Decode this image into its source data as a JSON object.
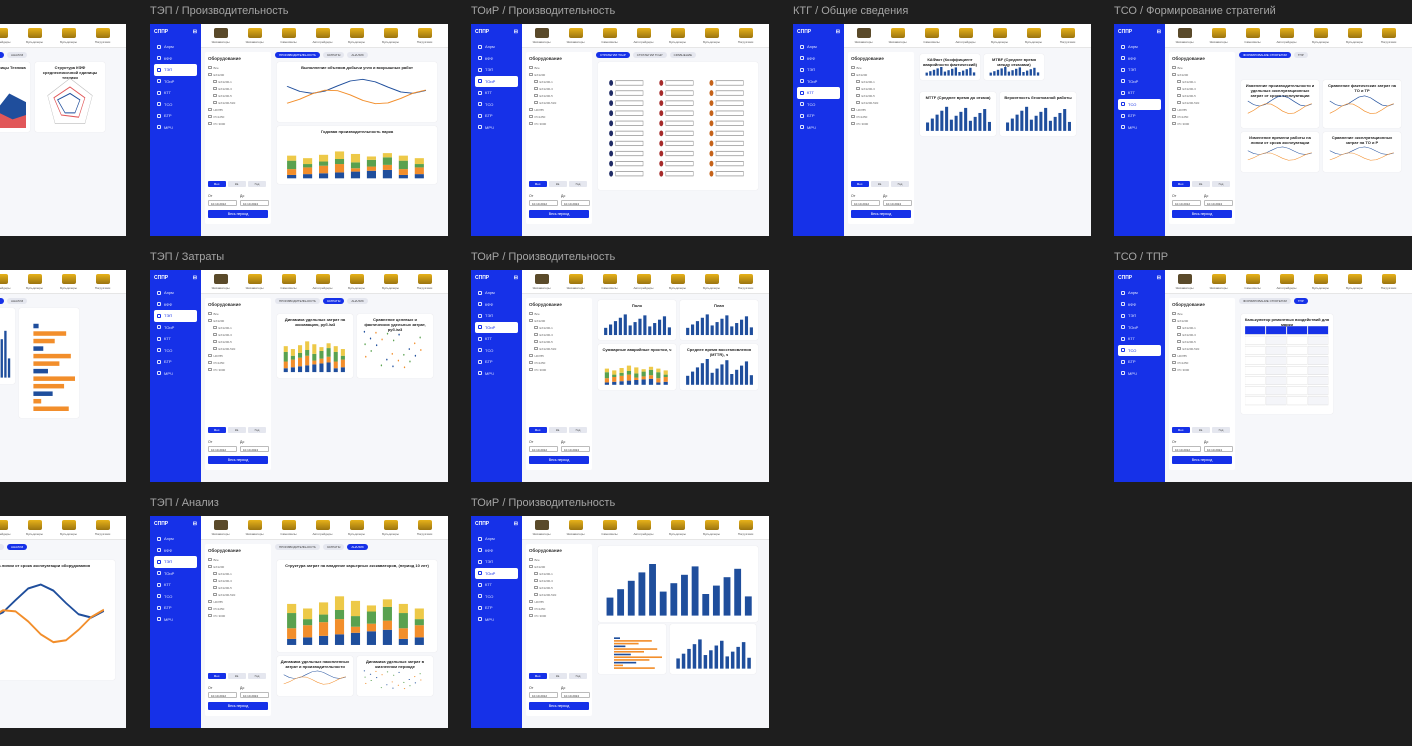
{
  "app": {
    "brand": "СППР"
  },
  "colors": {
    "sidebar": "#1631e8",
    "board_bg": "#ffffff",
    "canvas_bg": "#1e1e1e"
  },
  "sidebar_nav": [
    "Аэрм",
    "КФФ",
    "ТЭП",
    "ТОиР",
    "КТГ",
    "ТСО",
    "БТР",
    "МРЧ"
  ],
  "equipment": [
    "Экскаваторы",
    "Экскаваторы",
    "Самосвалы",
    "Автогрейдеры",
    "Бульдозеры",
    "Бульдозеры",
    "Погрузчики"
  ],
  "filters": {
    "title": "Оборудование",
    "items": [
      "Все",
      "EX1200",
      "EX1200-1",
      "EX1200-3",
      "EX1200-5",
      "EX1200-5КК",
      "HD785",
      "PC1250",
      "PC 3000"
    ],
    "periods": [
      "Мес.",
      "Кв.",
      "Год"
    ],
    "from_label": "От",
    "to_label": "До",
    "from_value": "10.10.2012",
    "to_value": "10.10.2024",
    "button": "Весь период"
  },
  "frames": [
    {
      "id": "f1",
      "title": "",
      "active_nav": 2,
      "tabs": [
        "",
        "ДЕТАЛЬНАЯ СТРУКТУРА КФФ",
        "АНАЛИЗ"
      ],
      "active_tab": 1,
      "cards": [
        {
          "title": "Структура КФФ единицы Техника",
          "chart": "area"
        },
        {
          "title": "Структура КФФ среднесписочной единицы техники",
          "chart": "radar"
        }
      ]
    },
    {
      "id": "f2",
      "title": "ТЭП / Производительность",
      "active_nav": 2,
      "tabs": [
        "ПРОИЗВОДИТЕЛЬНОСТЬ",
        "ЗАТРАТЫ",
        "АНАЛИЗ"
      ],
      "active_tab": 0,
      "cards": [
        {
          "title": "Выполнение объемов добычи угля и вскрышных работ",
          "chart": "line"
        },
        {
          "title": "Годовая производительность парка",
          "chart": "stack"
        }
      ]
    },
    {
      "id": "f3",
      "title": "ТОиР / Производительность",
      "active_nav": 3,
      "tabs": [
        "СТРАТЕГИИ ТОиР",
        "СТРАТЕГИИ ТОиР",
        "СРАВНЕНИЕ"
      ],
      "active_tab": 0,
      "cards": [
        {
          "title": "",
          "chart": "timeline"
        }
      ]
    },
    {
      "id": "f4",
      "title": "КТГ / Общие сведения",
      "active_nav": 4,
      "tabs": [],
      "active_tab": -1,
      "cards": [
        {
          "title": "КАФакт (Коэффициент аварийности фактический)",
          "chart": "bars"
        },
        {
          "title": "MTBF (Среднее время между отказами)",
          "chart": "bars"
        },
        {
          "title": "MTTF (Среднее время до отказа)",
          "chart": "bars"
        },
        {
          "title": "Вероятность безотказной работы",
          "chart": "bars"
        }
      ]
    },
    {
      "id": "f5",
      "title": "ТСО / Формирование стратегий",
      "active_nav": 5,
      "tabs": [
        "ФОРМИРОВАНИЕ СТРАТЕГИИ",
        "ТПР"
      ],
      "active_tab": 0,
      "cards": [
        {
          "title": "Изменение производительности и удельных эксплуатационных затрат от срока эксплуатации",
          "chart": "line"
        },
        {
          "title": "Сравнение фактических затрат на ТО и ТР",
          "chart": "line"
        },
        {
          "title": "Изменение времени работы на линии от срока эксплуатации",
          "chart": "line"
        },
        {
          "title": "Сравнение эксплуатационных затрат на ТО и Р",
          "chart": "line"
        }
      ]
    },
    {
      "id": "f6",
      "title": "",
      "active_nav": 2,
      "tabs": [
        "ДЕТАЛЬНАЯ СТРУКТУРА КФФ",
        "АНАЛИЗ"
      ],
      "active_tab": 0,
      "cards": [
        {
          "title": "",
          "chart": "bars"
        },
        {
          "title": "",
          "chart": "hbars"
        }
      ]
    },
    {
      "id": "f7",
      "title": "ТЭП / Затраты",
      "active_nav": 2,
      "tabs": [
        "ПРОИЗВОДИТЕЛЬНОСТЬ",
        "ЗАТРАТЫ",
        "АНАЛИЗ"
      ],
      "active_tab": 1,
      "cards": [
        {
          "title": "Динамика удельных затрат на экскавацию, руб./м3",
          "chart": "stack"
        },
        {
          "title": "Сравнение целевых и фактических удельных затрат, руб./м3",
          "chart": "scatter"
        }
      ]
    },
    {
      "id": "f8",
      "title": "ТОиР / Производительность",
      "active_nav": 3,
      "tabs": [],
      "active_tab": -1,
      "cards": [
        {
          "title": "Поло",
          "chart": "bars"
        },
        {
          "title": "План",
          "chart": "bars"
        },
        {
          "title": "Суммарные аварийные простои, ч",
          "chart": "stack"
        },
        {
          "title": "Среднее время восстановления (MTTR), ч",
          "chart": "bars"
        }
      ]
    },
    {
      "id": "f9",
      "title": "ТСО / ТПР",
      "active_nav": 5,
      "tabs": [
        "ФОРМИРОВАНИЕ СТРАТЕГИИ",
        "ТПР"
      ],
      "active_tab": 1,
      "cards": [
        {
          "title": "Калькулятор ремонтных воздействий для марки",
          "chart": "table"
        }
      ]
    },
    {
      "id": "f10",
      "title": "",
      "active_nav": 2,
      "tabs": [
        "ДЕТАЛЬНАЯ СТРУКТУРА КФФ",
        "АНАЛИЗ"
      ],
      "active_tab": 1,
      "cards": [
        {
          "title": "работы на линии от срока эксплуатации оборудования",
          "chart": "line"
        }
      ]
    },
    {
      "id": "f11",
      "title": "ТЭП / Анализ",
      "active_nav": 2,
      "tabs": [
        "ПРОИЗВОДИТЕЛЬНОСТЬ",
        "ЗАТРАТЫ",
        "АНАЛИЗ"
      ],
      "active_tab": 2,
      "cards": [
        {
          "title": "Структура затрат на владение карьерных экскаваторов, (период 10 лет)",
          "chart": "stack"
        },
        {
          "title": "Динамика удельных накопленных затрат и производительности",
          "chart": "line"
        },
        {
          "title": "Динамика удельных затрат в жизненном периоде",
          "chart": "scatter"
        }
      ]
    },
    {
      "id": "f12",
      "title": "ТОиР / Производительность",
      "active_nav": 3,
      "tabs": [],
      "active_tab": -1,
      "cards": [
        {
          "title": "",
          "chart": "bars"
        },
        {
          "title": "",
          "chart": "hbars"
        },
        {
          "title": "",
          "chart": "bars"
        }
      ]
    }
  ]
}
